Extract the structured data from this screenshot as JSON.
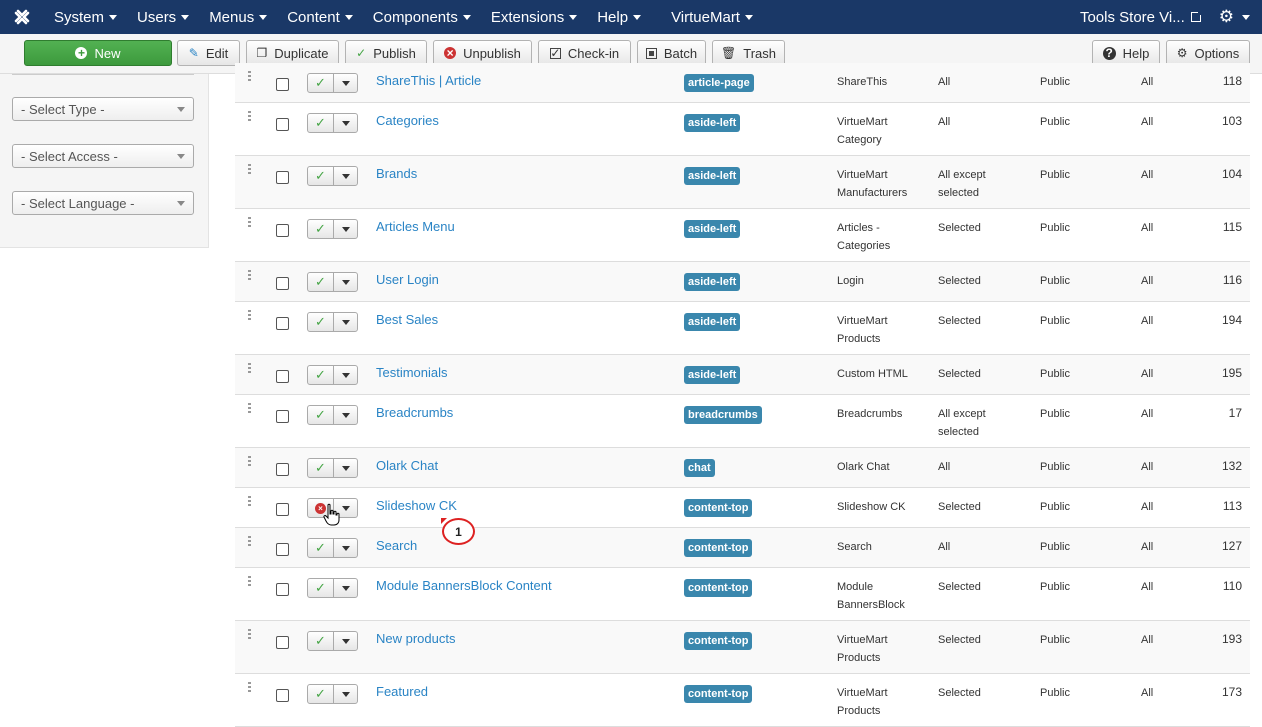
{
  "navbar": {
    "menus": [
      {
        "label": "System",
        "name": "nav-system"
      },
      {
        "label": "Users",
        "name": "nav-users"
      },
      {
        "label": "Menus",
        "name": "nav-menus"
      },
      {
        "label": "Content",
        "name": "nav-content"
      },
      {
        "label": "Components",
        "name": "nav-components"
      },
      {
        "label": "Extensions",
        "name": "nav-extensions"
      },
      {
        "label": "Help",
        "name": "nav-help"
      },
      {
        "label": "VirtueMart",
        "name": "nav-virtuemart"
      }
    ],
    "site_name": "Tools Store Vi..."
  },
  "toolbar": {
    "new": "New",
    "edit": "Edit",
    "duplicate": "Duplicate",
    "publish": "Publish",
    "unpublish": "Unpublish",
    "checkin": "Check-in",
    "batch": "Batch",
    "trash": "Trash",
    "help": "Help",
    "options": "Options"
  },
  "filters": {
    "type": "- Select Type -",
    "access": "- Select Access -",
    "language": "- Select Language -"
  },
  "rows": [
    {
      "title": "ShareThis | Article",
      "position": "article-page",
      "type": "ShareThis",
      "pages": "All",
      "access": "Public",
      "lang": "All",
      "id": "118",
      "published": true
    },
    {
      "title": "Categories",
      "position": "aside-left",
      "type": "VirtueMart Category",
      "pages": "All",
      "access": "Public",
      "lang": "All",
      "id": "103",
      "published": true
    },
    {
      "title": "Brands",
      "position": "aside-left",
      "type": "VirtueMart Manufacturers",
      "pages": "All except selected",
      "access": "Public",
      "lang": "All",
      "id": "104",
      "published": true
    },
    {
      "title": "Articles Menu",
      "position": "aside-left",
      "type": "Articles - Categories",
      "pages": "Selected",
      "access": "Public",
      "lang": "All",
      "id": "115",
      "published": true
    },
    {
      "title": "User Login",
      "position": "aside-left",
      "type": "Login",
      "pages": "Selected",
      "access": "Public",
      "lang": "All",
      "id": "116",
      "published": true
    },
    {
      "title": "Best Sales",
      "position": "aside-left",
      "type": "VirtueMart Products",
      "pages": "Selected",
      "access": "Public",
      "lang": "All",
      "id": "194",
      "published": true
    },
    {
      "title": "Testimonials",
      "position": "aside-left",
      "type": "Custom HTML",
      "pages": "Selected",
      "access": "Public",
      "lang": "All",
      "id": "195",
      "published": true
    },
    {
      "title": "Breadcrumbs",
      "position": "breadcrumbs",
      "type": "Breadcrumbs",
      "pages": "All except selected",
      "access": "Public",
      "lang": "All",
      "id": "17",
      "published": true
    },
    {
      "title": "Olark Chat",
      "position": "chat",
      "type": "Olark Chat",
      "pages": "All",
      "access": "Public",
      "lang": "All",
      "id": "132",
      "published": true
    },
    {
      "title": "Slideshow CK",
      "position": "content-top",
      "type": "Slideshow CK",
      "pages": "Selected",
      "access": "Public",
      "lang": "All",
      "id": "113",
      "published": false
    },
    {
      "title": "Search",
      "position": "content-top",
      "type": "Search",
      "pages": "All",
      "access": "Public",
      "lang": "All",
      "id": "127",
      "published": true
    },
    {
      "title": "Module BannersBlock Content",
      "position": "content-top",
      "type": "Module BannersBlock",
      "pages": "Selected",
      "access": "Public",
      "lang": "All",
      "id": "110",
      "published": true
    },
    {
      "title": "New products",
      "position": "content-top",
      "type": "VirtueMart Products",
      "pages": "Selected",
      "access": "Public",
      "lang": "All",
      "id": "193",
      "published": true
    },
    {
      "title": "Featured",
      "position": "content-top",
      "type": "VirtueMart Products",
      "pages": "Selected",
      "access": "Public",
      "lang": "All",
      "id": "173",
      "published": true
    }
  ],
  "annotation": {
    "marker": "1"
  },
  "colors": {
    "navbar": "#1a3867",
    "link": "#2a84c5",
    "badge": "#3a87ad",
    "new_button": "#46a546",
    "marker": "#dd2222"
  }
}
